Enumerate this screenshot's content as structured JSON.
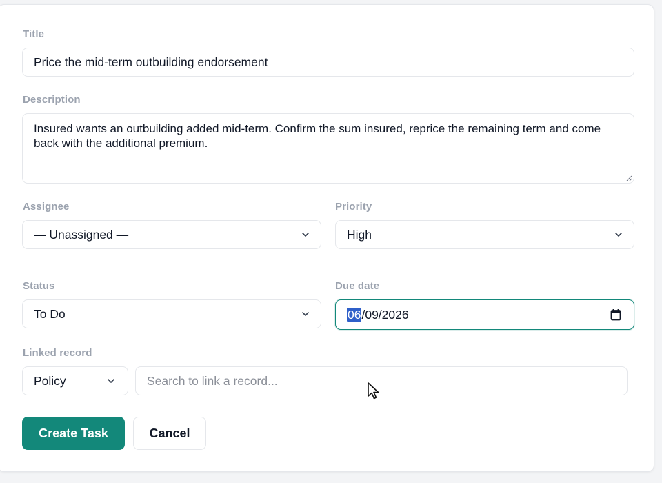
{
  "form": {
    "title": {
      "label": "Title",
      "value": "Price the mid-term outbuilding endorsement"
    },
    "description": {
      "label": "Description",
      "value": "Insured wants an outbuilding added mid-term. Confirm the sum insured, reprice the remaining term and come back with the additional premium."
    },
    "assignee": {
      "label": "Assignee",
      "selected": "— Unassigned —"
    },
    "priority": {
      "label": "Priority",
      "selected": "High"
    },
    "status": {
      "label": "Status",
      "selected": "To Do"
    },
    "due_date": {
      "label": "Due date",
      "month": "06",
      "rest": "/09/2026"
    },
    "linked_record": {
      "label": "Linked record",
      "type_selected": "Policy",
      "search_placeholder": "Search to link a record..."
    },
    "buttons": {
      "create": "Create Task",
      "cancel": "Cancel"
    }
  },
  "colors": {
    "accent": "#13887a",
    "label": "#9ca3af",
    "selection": "#2f5fc9"
  },
  "icons": {
    "select_chevron": "chevron-down-icon",
    "date_picker": "calendar-icon",
    "pointer": "mouse-cursor-icon"
  }
}
